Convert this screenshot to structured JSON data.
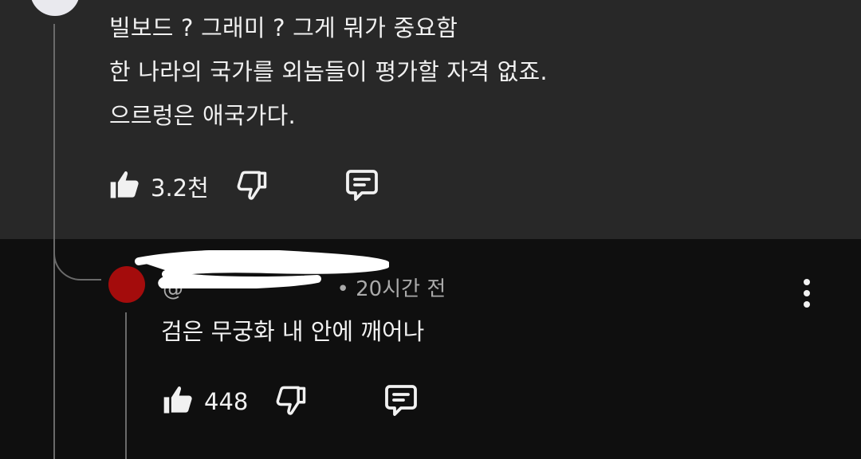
{
  "parent_comment": {
    "lines": [
      "빌보드 ? 그래미 ? 그게 뭐가 중요함",
      "한 나라의 국가를 외놈들이 평가할 자격 없죠.",
      "으르렁은 애국가다."
    ],
    "like_count": "3.2천"
  },
  "reply": {
    "author": "@",
    "time": "• 20시간 전",
    "text": "검은 무궁화 내 안에 깨어나",
    "like_count": "448",
    "avatar_color": "#a40c0c"
  },
  "icons": {
    "like": "thumbs-up-icon",
    "dislike": "thumbs-down-icon",
    "reply": "comment-icon",
    "more": "more-vert-icon"
  },
  "colors": {
    "parent_bg": "#282828",
    "reply_bg": "#0f0f0f",
    "text": "#f1f1f1",
    "meta": "#aaaaaa"
  }
}
